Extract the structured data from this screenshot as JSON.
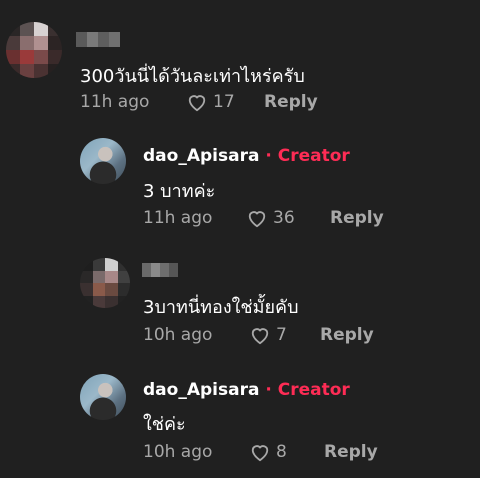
{
  "comments": [
    {
      "username": "",
      "creator_tag": "",
      "text": "300วันนี่ได้วันละเท่าไหร่ครับ",
      "time": "11h ago",
      "likes": "17",
      "reply_label": "Reply"
    },
    {
      "username": "dao_Apisara",
      "creator_tag": "· Creator",
      "text": "3 บาทค่ะ",
      "time": "11h ago",
      "likes": "36",
      "reply_label": "Reply"
    },
    {
      "username": "",
      "creator_tag": "",
      "text": "3บาทนี่ทองใช่มั้ยคับ",
      "time": "10h ago",
      "likes": "7",
      "reply_label": "Reply"
    },
    {
      "username": "dao_Apisara",
      "creator_tag": "· Creator",
      "text": "ใช่ค่ะ",
      "time": "10h ago",
      "likes": "8",
      "reply_label": "Reply"
    }
  ],
  "colors": {
    "background": "#202020",
    "creator_accent": "#fe2c55",
    "meta_text": "#a8a8a8"
  },
  "icons": [
    "heart-outline-icon"
  ]
}
